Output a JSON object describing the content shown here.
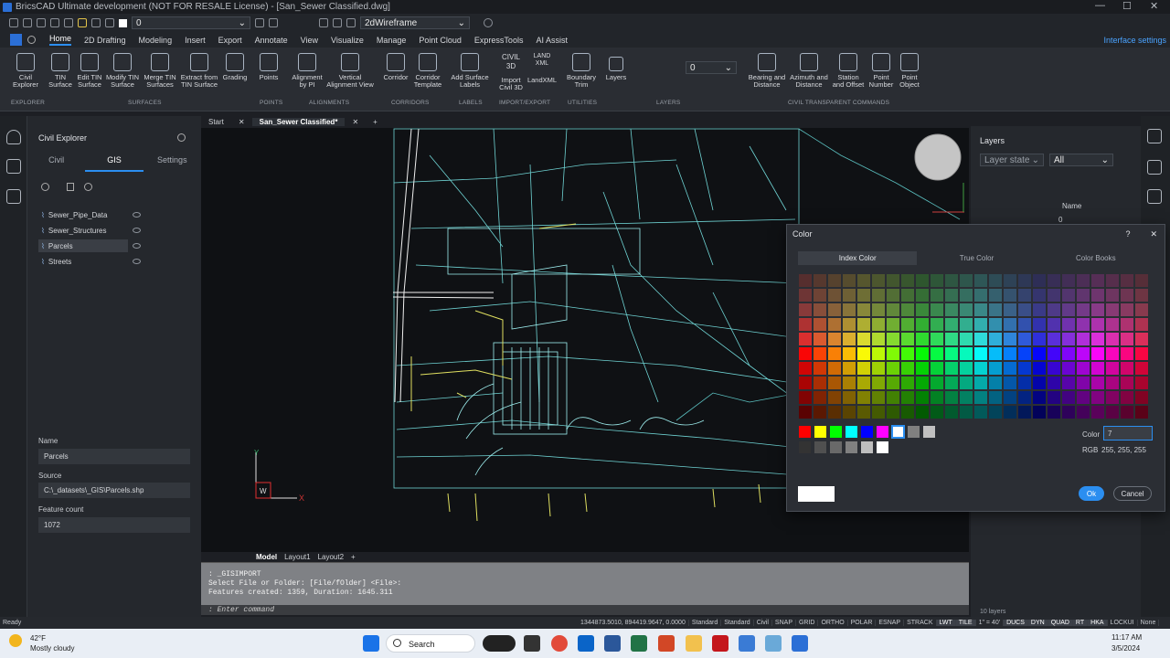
{
  "app": {
    "title": "BricsCAD Ultimate development (NOT FOR RESALE License) - [San_Sewer Classified.dwg]"
  },
  "qat": {
    "layer_value": "0",
    "visual_style": "2dWireframe"
  },
  "menu": [
    "Home",
    "2D Drafting",
    "Modeling",
    "Insert",
    "Export",
    "Annotate",
    "View",
    "Visualize",
    "Manage",
    "Point Cloud",
    "ExpressTools",
    "AI Assist"
  ],
  "menu_active": "Home",
  "interface_settings": "Interface settings",
  "ribbon": {
    "buttons": [
      {
        "label": "Civil\nExplorer"
      },
      {
        "label": "TIN\nSurface"
      },
      {
        "label": "Edit TIN\nSurface"
      },
      {
        "label": "Modify TIN\nSurface"
      },
      {
        "label": "Merge TIN\nSurfaces"
      },
      {
        "label": "Extract from\nTIN Surface"
      },
      {
        "label": "Grading"
      },
      {
        "label": "Points"
      },
      {
        "label": "Alignment\nby PI"
      },
      {
        "label": "Vertical\nAlignment View"
      },
      {
        "label": "Corridor"
      },
      {
        "label": "Corridor\nTemplate"
      },
      {
        "label": "Add Surface\nLabels"
      },
      {
        "label": "Import\nCivil 3D"
      },
      {
        "label": "LandXML"
      },
      {
        "label": "Boundary\nTrim"
      },
      {
        "label": "Layers"
      },
      {
        "label": "Bearing and\nDistance"
      },
      {
        "label": "Azimuth and\nDistance"
      },
      {
        "label": "Station\nand Offset"
      },
      {
        "label": "Point\nNumber"
      },
      {
        "label": "Point\nObject"
      }
    ],
    "panels": [
      "EXPLORER",
      "SURFACES",
      "POINTS",
      "ALIGNMENTS",
      "CORRIDORS",
      "LABELS",
      "IMPORT/EXPORT",
      "UTILITIES",
      "LAYERS",
      "CIVIL TRANSPARENT COMMANDS"
    ],
    "civil3d_label": "CIVIL\n3D",
    "landxml_label": "LAND\nXML",
    "layer_value": "0"
  },
  "explorer": {
    "title": "Civil Explorer",
    "tabs": [
      "Civil",
      "GIS",
      "Settings"
    ],
    "active_tab": "GIS",
    "items": [
      "Sewer_Pipe_Data",
      "Sewer_Structures",
      "Parcels",
      "Streets"
    ],
    "selected": "Parcels",
    "name_label": "Name",
    "name_value": "Parcels",
    "source_label": "Source",
    "source_value": "C:\\_datasets\\_GIS\\Parcels.shp",
    "count_label": "Feature count",
    "count_value": "1072"
  },
  "doctabs": [
    "Start",
    "San_Sewer Classified*"
  ],
  "layout_tabs": [
    "Model",
    "Layout1",
    "Layout2"
  ],
  "command": {
    "history": ": _GISIMPORT\nSelect File or Folder: [File/fOlder] <File>:\nFeatures created: 1359, Duration: 1645.311",
    "prompt": ": Enter command"
  },
  "layers": {
    "title": "Layers",
    "state_placeholder": "Layer state",
    "filter": "All",
    "col_name": "Name",
    "row_name": "0",
    "count": "10 layers"
  },
  "dialog": {
    "title": "Color",
    "help": "?",
    "tabs": [
      "Index Color",
      "True Color",
      "Color Books"
    ],
    "active_tab": "Index Color",
    "color_label": "Color",
    "color_value": "7",
    "rgb_label": "RGB",
    "rgb_value": "255, 255, 255",
    "ok": "Ok",
    "cancel": "Cancel",
    "preview_color": "#ffffff",
    "accent": "#2b8ef0"
  },
  "status": {
    "ready": "Ready",
    "coords": "1344873.5010, 894419.9647, 0.0000",
    "items": [
      "Standard",
      "Standard",
      "Civil",
      "SNAP",
      "GRID",
      "ORTHO",
      "POLAR",
      "ESNAP",
      "STRACK",
      "LWT",
      "TILE",
      "1\" = 40'",
      "DUCS",
      "DYN",
      "QUAD",
      "RT",
      "HKA",
      "LOCKUI",
      "None"
    ]
  },
  "taskbar": {
    "temp": "42°F",
    "weather": "Mostly cloudy",
    "search": "Search",
    "time": "11:17 AM",
    "date": "3/5/2024"
  },
  "canvas": {
    "line_color": "#7fe0e0",
    "accent_color": "#e0e060",
    "bg": "#0f1114",
    "ucs_x": "X",
    "ucs_y": "Y",
    "ucs_w": "W"
  }
}
